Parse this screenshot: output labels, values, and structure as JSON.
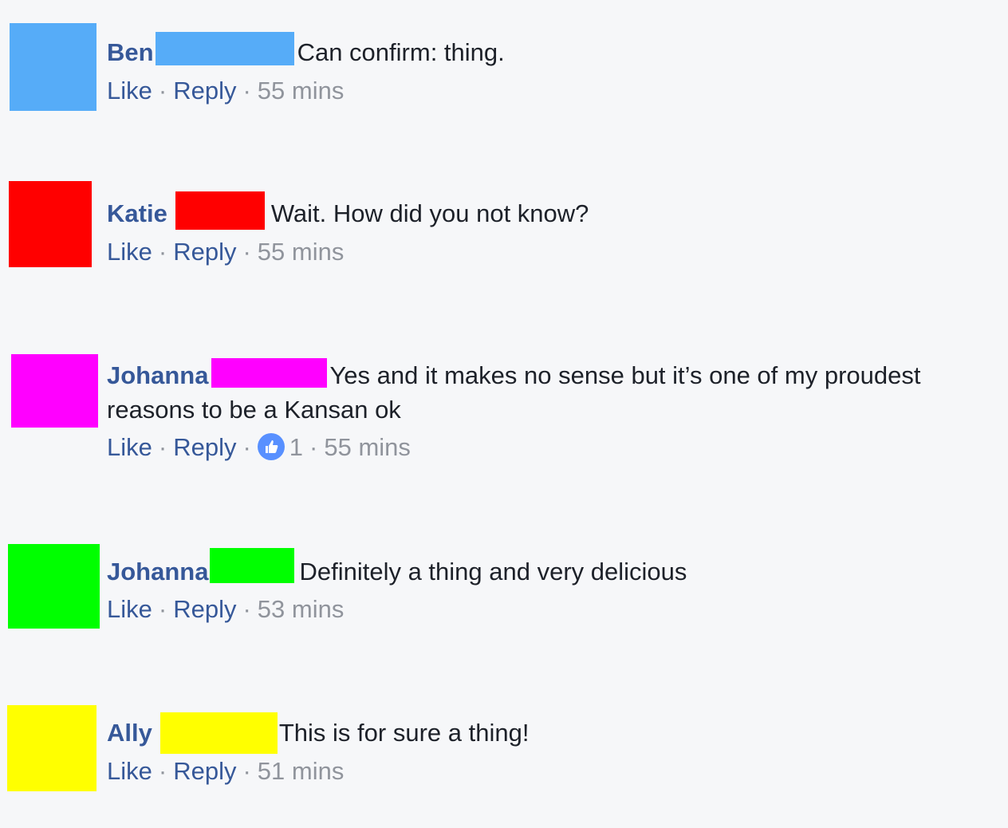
{
  "comments": [
    {
      "author": "Ben",
      "avatar_color": "#56acf8",
      "redact_color": "#56acf8",
      "message": "Can confirm: thing.",
      "actions": {
        "like": "Like",
        "reply": "Reply",
        "time": "55 mins"
      }
    },
    {
      "author": "Katie",
      "avatar_color": "#ff0000",
      "redact_color": "#ff0000",
      "message": "Wait. How did you not know?",
      "actions": {
        "like": "Like",
        "reply": "Reply",
        "time": "55 mins"
      }
    },
    {
      "author": "Johanna",
      "avatar_color": "#ff00ff",
      "redact_color": "#ff00ff",
      "message_line1": "Yes and it makes no sense but it’s one of my proudest",
      "message_line2": "reasons to be a Kansan ok",
      "actions": {
        "like": "Like",
        "reply": "Reply",
        "reaction_count": "1",
        "time": "55 mins"
      }
    },
    {
      "author": "Johanna",
      "avatar_color": "#00ff00",
      "redact_color": "#00ff00",
      "message": "Definitely a thing and very delicious",
      "actions": {
        "like": "Like",
        "reply": "Reply",
        "time": "53 mins"
      }
    },
    {
      "author": "Ally",
      "avatar_color": "#ffff00",
      "redact_color": "#ffff00",
      "message": "This is for sure a thing!",
      "actions": {
        "like": "Like",
        "reply": "Reply",
        "time": "51 mins"
      }
    }
  ]
}
